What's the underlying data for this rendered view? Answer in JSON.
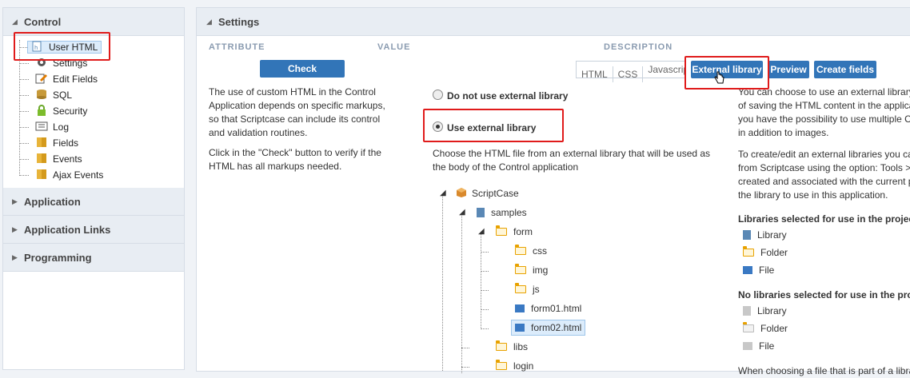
{
  "sidebar": {
    "control_title": "Control",
    "items": [
      {
        "label": "User HTML",
        "icon": "html-file-icon"
      },
      {
        "label": "Settings",
        "icon": "gear-icon"
      },
      {
        "label": "Edit Fields",
        "icon": "edit-icon"
      },
      {
        "label": "SQL",
        "icon": "database-icon"
      },
      {
        "label": "Security",
        "icon": "lock-icon"
      },
      {
        "label": "Log",
        "icon": "log-icon"
      },
      {
        "label": "Fields",
        "icon": "book-icon"
      },
      {
        "label": "Events",
        "icon": "book-icon"
      },
      {
        "label": "Ajax Events",
        "icon": "book-icon"
      }
    ],
    "sections": [
      "Application",
      "Application Links",
      "Programming"
    ]
  },
  "main": {
    "title": "Settings",
    "columns": {
      "attribute": "ATTRIBUTE",
      "value": "VALUE",
      "description": "DESCRIPTION"
    },
    "check_label": "Check",
    "tabs": [
      "HTML",
      "CSS",
      "Javascript"
    ],
    "buttons": {
      "external": "External library",
      "preview": "Preview",
      "create": "Create fields"
    },
    "left_text1_lines": [
      "The use of custom HTML in the Control",
      "Application depends on specific markups,",
      "so that Scriptcase can include its control",
      "and validation routines."
    ],
    "left_text2_lines": [
      "Click in the \"Check\" button to verify if the",
      "HTML has all markups needed."
    ],
    "radio_no": "Do not use external library",
    "radio_yes": "Use external library",
    "choose_lines": [
      "Choose the HTML file from an external library that will be used as",
      "the body of the Control application"
    ],
    "tree": {
      "root": "ScriptCase",
      "samples": "samples",
      "form": "form",
      "css": "css",
      "img": "img",
      "js": "js",
      "form01": "form01.html",
      "form02": "form02.html",
      "libs": "libs",
      "login": "login"
    },
    "desc_lines1": [
      "You can choose to use an external library",
      "of saving the HTML content in the applica",
      "you have the possibility to use multiple C",
      "in addition to images."
    ],
    "desc_lines2": [
      "To create/edit an external libraries you ca",
      "from Scriptcase using the option: Tools >",
      "created and associated with the current p",
      "the library to use in this application."
    ],
    "selected_heading": "Libraries selected for use in the projec",
    "legend_selected": [
      "Library",
      "Folder",
      "File"
    ],
    "not_selected_heading": "No libraries selected for use in the pro",
    "legend_not_selected": [
      "Library",
      "Folder",
      "File"
    ],
    "bottom_cut": "When choosing a file that is part of a libra"
  },
  "colors": {
    "accent": "#3275b8",
    "highlight": "#e01b1b"
  }
}
